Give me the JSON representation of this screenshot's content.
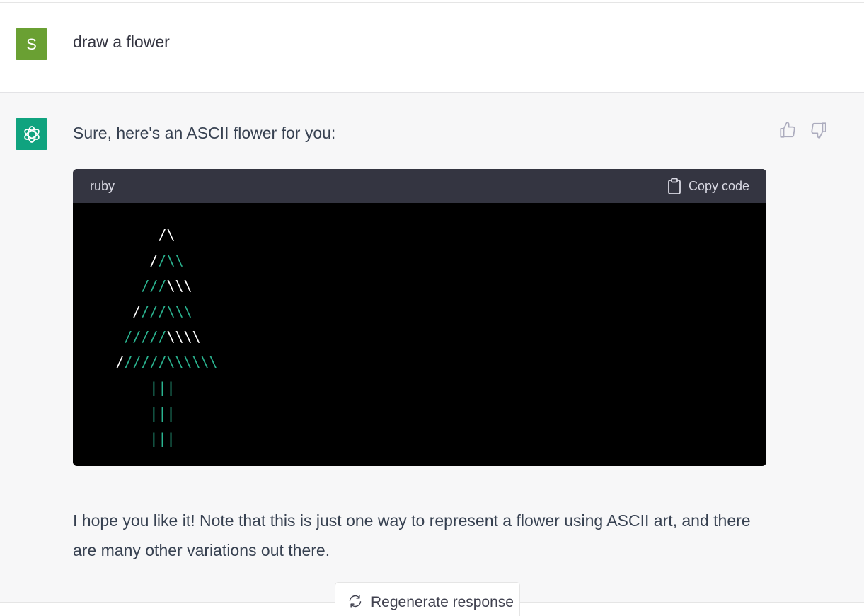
{
  "user": {
    "avatar_letter": "S",
    "message": "draw a flower"
  },
  "assistant": {
    "intro": "Sure, here's an ASCII flower for you:",
    "code_block": {
      "language": "ruby",
      "copy_label": "Copy code",
      "lines": [
        {
          "indent": "          ",
          "parts": [
            {
              "t": "/\\",
              "c": "w"
            }
          ]
        },
        {
          "indent": "         ",
          "parts": [
            {
              "t": "/",
              "c": "w"
            },
            {
              "t": "/\\\\",
              "c": "g"
            }
          ]
        },
        {
          "indent": "        ",
          "parts": [
            {
              "t": "///",
              "c": "g"
            },
            {
              "t": "\\\\\\",
              "c": "w"
            }
          ]
        },
        {
          "indent": "       ",
          "parts": [
            {
              "t": "/",
              "c": "w"
            },
            {
              "t": "///\\\\\\",
              "c": "g"
            }
          ]
        },
        {
          "indent": "      ",
          "parts": [
            {
              "t": "/////",
              "c": "g"
            },
            {
              "t": "\\\\\\\\",
              "c": "w"
            }
          ]
        },
        {
          "indent": "     ",
          "parts": [
            {
              "t": "/",
              "c": "w"
            },
            {
              "t": "/////\\\\\\\\\\\\",
              "c": "g"
            }
          ]
        },
        {
          "indent": "         ",
          "parts": [
            {
              "t": "|||",
              "c": "g"
            }
          ]
        },
        {
          "indent": "         ",
          "parts": [
            {
              "t": "|||",
              "c": "g"
            }
          ]
        },
        {
          "indent": "         ",
          "parts": [
            {
              "t": "|||",
              "c": "g"
            }
          ]
        }
      ]
    },
    "outro": "I hope you like it! Note that this is just one way to represent a flower using ASCII art, and there are many other variations out there."
  },
  "actions": {
    "regenerate_label": "Regenerate response"
  },
  "icons": {
    "bot_avatar": "openai-logo-icon",
    "thumbs_up": "thumbs-up-icon",
    "thumbs_down": "thumbs-down-icon",
    "copy": "clipboard-icon",
    "regenerate": "refresh-icon"
  },
  "colors": {
    "user_avatar": "#6aa033",
    "bot_avatar": "#10a37f",
    "code_green": "#2ab38f"
  }
}
